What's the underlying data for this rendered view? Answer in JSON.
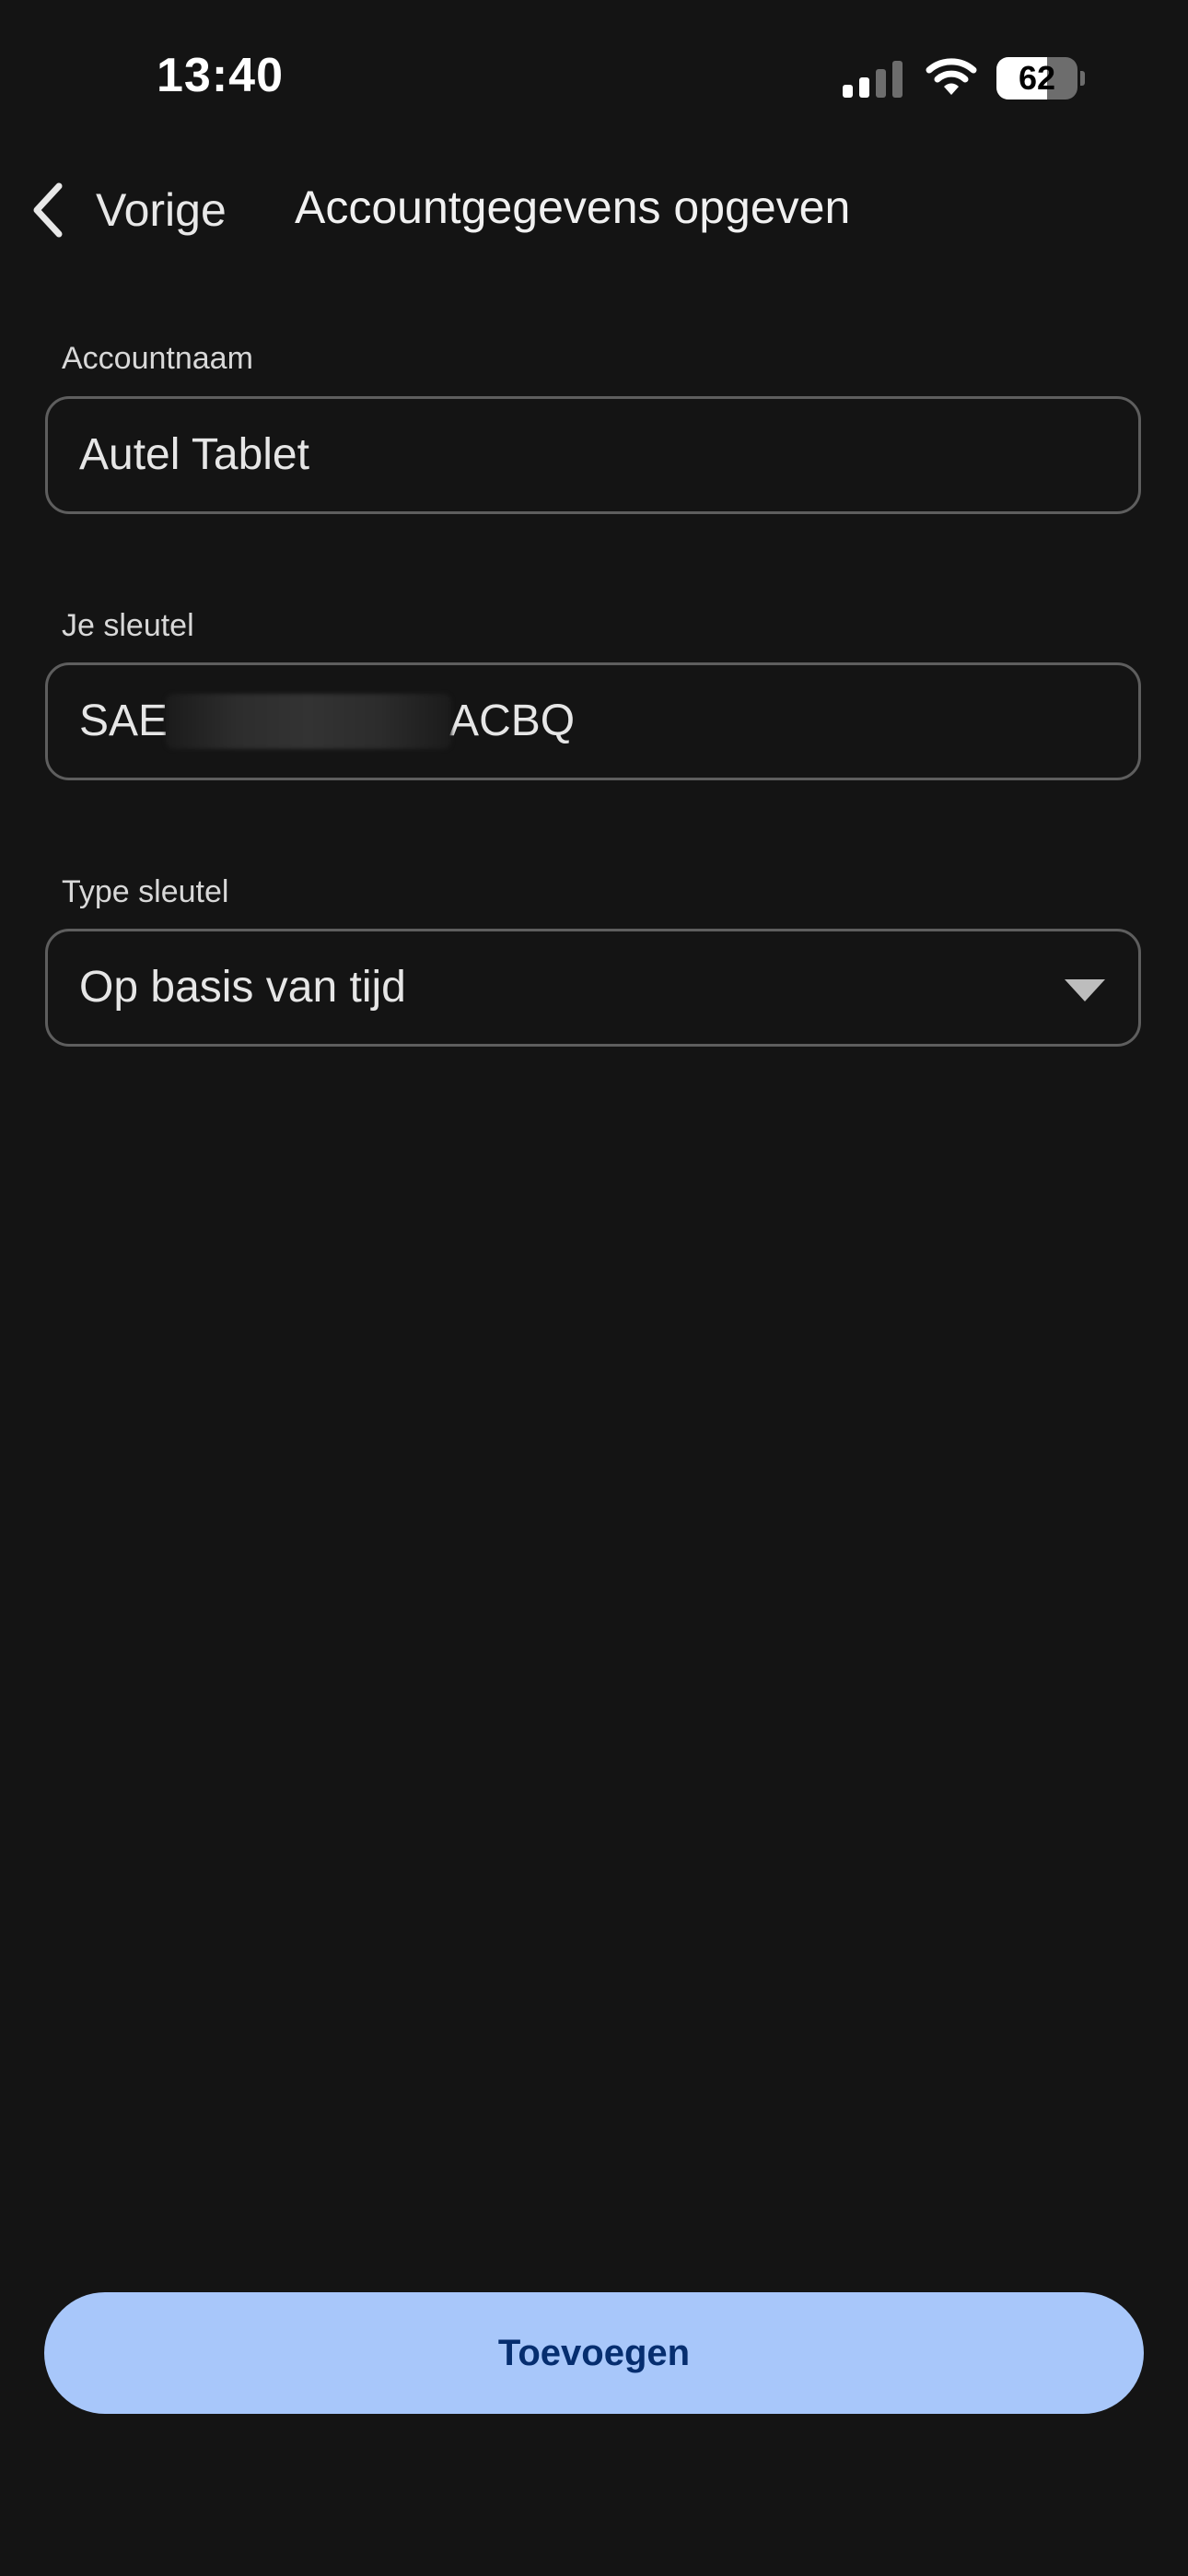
{
  "status_bar": {
    "time": "13:40",
    "battery_level": "62",
    "battery_fraction": 0.62,
    "signal_icon": "cellular-signal-icon",
    "wifi_icon": "wifi-icon"
  },
  "header": {
    "back_label": "Vorige",
    "back_icon": "chevron-left-icon",
    "title": "Accountgegevens opgeven"
  },
  "form": {
    "account_name": {
      "label": "Accountnaam",
      "value": "Autel Tablet"
    },
    "key": {
      "label": "Je sleutel",
      "value_prefix": "SAE",
      "value_suffix": "ACBQ"
    },
    "key_type": {
      "label": "Type sleutel",
      "selected": "Op basis van tijd",
      "icon": "dropdown-arrow-icon"
    }
  },
  "actions": {
    "add_label": "Toevoegen"
  },
  "colors": {
    "background": "#141414",
    "accent": "#a8c7fa",
    "accent_text": "#062e6f",
    "field_border": "#5e5e5e"
  }
}
